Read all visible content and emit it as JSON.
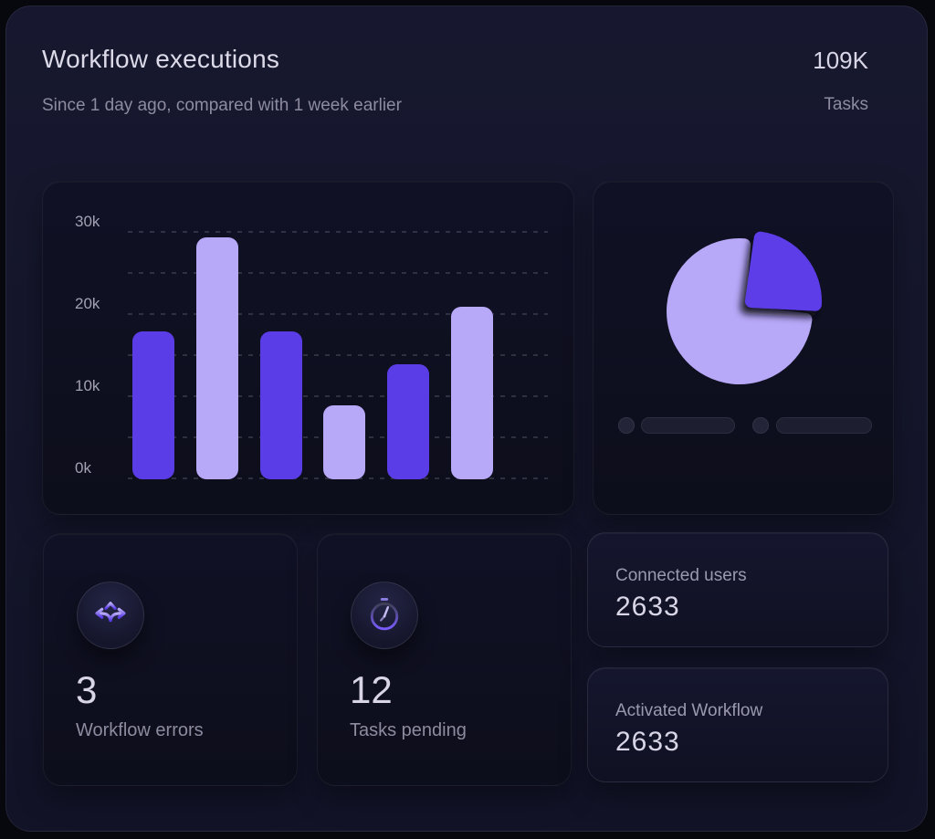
{
  "header": {
    "title": "Workflow executions",
    "subtitle": "Since 1 day ago, compared with 1 week earlier",
    "stat_value": "109K",
    "stat_label": "Tasks"
  },
  "chart_data": [
    {
      "type": "bar",
      "values": [
        18000,
        29500,
        18000,
        9000,
        14000,
        21000
      ],
      "bar_colors": [
        "#5b3de8",
        "#b7a8f8"
      ],
      "yticks": [
        {
          "label": "0k",
          "value": 0
        },
        {
          "label": "10k",
          "value": 10000
        },
        {
          "label": "20k",
          "value": 20000
        },
        {
          "label": "30k",
          "value": 30000
        }
      ],
      "ylim": [
        0,
        30000
      ],
      "gridline_step": 5000,
      "grid": "dashed-horizontal",
      "x_tick_labels": "none"
    },
    {
      "type": "pie",
      "slices": [
        {
          "name": "primary",
          "value": 73,
          "color": "#b7a8f8",
          "exploded": false
        },
        {
          "name": "secondary",
          "value": 27,
          "color": "#5b3de8",
          "exploded": true
        }
      ],
      "legend": "two-skeleton-placeholder-rows-no-text"
    }
  ],
  "cards": {
    "workflow_errors": {
      "value": "3",
      "label": "Workflow errors",
      "icon": "split-arrows-icon"
    },
    "tasks_pending": {
      "value": "12",
      "label": "Tasks pending",
      "icon": "stopwatch-icon"
    },
    "connected_users": {
      "label": "Connected users",
      "value": "2633"
    },
    "activated_workflow": {
      "label": "Activated Workflow",
      "value": "2633"
    }
  },
  "colors": {
    "accent_purple": "#5b3de8",
    "accent_lavender": "#b7a8f8",
    "panel_bg": "#14152a",
    "card_bg": "#0e0f1e",
    "text_primary": "#d8d6e6",
    "text_muted": "#8d8b9f"
  }
}
